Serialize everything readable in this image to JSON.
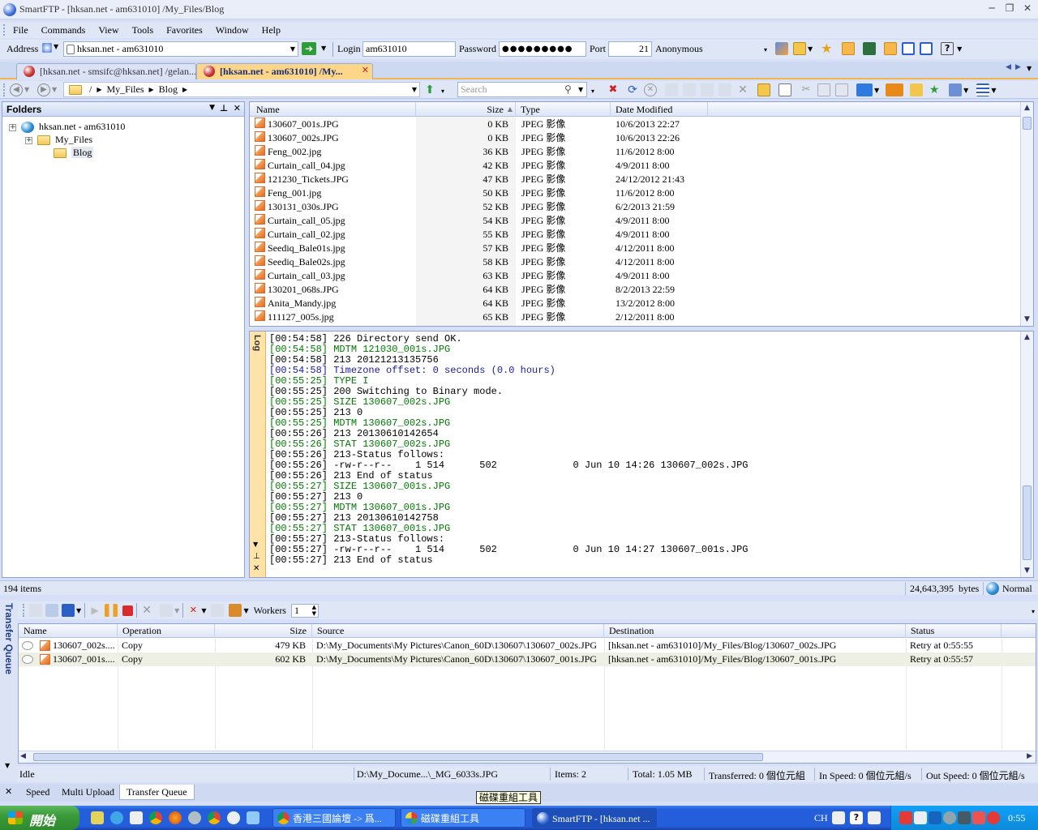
{
  "window": {
    "title": "SmartFTP - [hksan.net - am631010] /My_Files/Blog"
  },
  "menu": [
    "File",
    "Commands",
    "View",
    "Tools",
    "Favorites",
    "Window",
    "Help"
  ],
  "address_bar": {
    "address_label": "Address",
    "address_value": "hksan.net - am631010",
    "login_label": "Login",
    "login_value": "am631010",
    "password_label": "Password",
    "password_value": "●●●●●●●●●",
    "port_label": "Port",
    "port_value": "21",
    "anonymous_label": "Anonymous"
  },
  "tabs": [
    {
      "label": "[hksan.net - smsifc@hksan.net] /gelan...",
      "active": false
    },
    {
      "label": "[hksan.net - am631010] /My...",
      "active": true
    }
  ],
  "nav": {
    "path": [
      "/",
      "My_Files",
      "Blog"
    ],
    "search_placeholder": "Search"
  },
  "folders": {
    "header": "Folders",
    "tree": [
      {
        "label": "hksan.net - am631010",
        "level": 0,
        "expander": "+"
      },
      {
        "label": "My_Files",
        "level": 1,
        "expander": "+"
      },
      {
        "label": "Blog",
        "level": 2,
        "expander": ""
      }
    ]
  },
  "files": {
    "columns": [
      "Name",
      "Size",
      "Type",
      "Date Modified"
    ],
    "rows": [
      {
        "name": "130607_001s.JPG",
        "size": "0 KB",
        "type": "JPEG 影像",
        "date": "10/6/2013 22:27"
      },
      {
        "name": "130607_002s.JPG",
        "size": "0 KB",
        "type": "JPEG 影像",
        "date": "10/6/2013 22:26"
      },
      {
        "name": "Feng_002.jpg",
        "size": "36 KB",
        "type": "JPEG 影像",
        "date": "11/6/2012 8:00"
      },
      {
        "name": "Curtain_call_04.jpg",
        "size": "42 KB",
        "type": "JPEG 影像",
        "date": "4/9/2011 8:00"
      },
      {
        "name": "121230_Tickets.JPG",
        "size": "47 KB",
        "type": "JPEG 影像",
        "date": "24/12/2012 21:43"
      },
      {
        "name": "Feng_001.jpg",
        "size": "50 KB",
        "type": "JPEG 影像",
        "date": "11/6/2012 8:00"
      },
      {
        "name": "130131_030s.JPG",
        "size": "52 KB",
        "type": "JPEG 影像",
        "date": "6/2/2013 21:59"
      },
      {
        "name": "Curtain_call_05.jpg",
        "size": "54 KB",
        "type": "JPEG 影像",
        "date": "4/9/2011 8:00"
      },
      {
        "name": "Curtain_call_02.jpg",
        "size": "55 KB",
        "type": "JPEG 影像",
        "date": "4/9/2011 8:00"
      },
      {
        "name": "Seediq_Bale01s.jpg",
        "size": "57 KB",
        "type": "JPEG 影像",
        "date": "4/12/2011 8:00"
      },
      {
        "name": "Seediq_Bale02s.jpg",
        "size": "58 KB",
        "type": "JPEG 影像",
        "date": "4/12/2011 8:00"
      },
      {
        "name": "Curtain_call_03.jpg",
        "size": "63 KB",
        "type": "JPEG 影像",
        "date": "4/9/2011 8:00"
      },
      {
        "name": "130201_068s.JPG",
        "size": "64 KB",
        "type": "JPEG 影像",
        "date": "8/2/2013 22:59"
      },
      {
        "name": "Anita_Mandy.jpg",
        "size": "64 KB",
        "type": "JPEG 影像",
        "date": "13/2/2012 8:00"
      },
      {
        "name": "111127_005s.jpg",
        "size": "65 KB",
        "type": "JPEG 影像",
        "date": "2/12/2011 8:00"
      }
    ]
  },
  "log": {
    "label": "Log",
    "colors": {
      "command": "#007a00",
      "reply": "#000000",
      "info": "#1a1aa0"
    },
    "lines": [
      {
        "text": "[00:54:58] 226 Directory send OK.",
        "kind": "reply"
      },
      {
        "text": "[00:54:58] MDTM 121030_001s.JPG",
        "kind": "command"
      },
      {
        "text": "[00:54:58] 213 20121213135756",
        "kind": "reply"
      },
      {
        "text": "[00:54:58] Timezone offset: 0 seconds (0.0 hours)",
        "kind": "info"
      },
      {
        "text": "[00:55:25] TYPE I",
        "kind": "command"
      },
      {
        "text": "[00:55:25] 200 Switching to Binary mode.",
        "kind": "reply"
      },
      {
        "text": "[00:55:25] SIZE 130607_002s.JPG",
        "kind": "command"
      },
      {
        "text": "[00:55:25] 213 0",
        "kind": "reply"
      },
      {
        "text": "[00:55:25] MDTM 130607_002s.JPG",
        "kind": "command"
      },
      {
        "text": "[00:55:26] 213 20130610142654",
        "kind": "reply"
      },
      {
        "text": "[00:55:26] STAT 130607_002s.JPG",
        "kind": "command"
      },
      {
        "text": "[00:55:26] 213-Status follows:",
        "kind": "reply"
      },
      {
        "text": "[00:55:26] -rw-r--r--    1 514      502             0 Jun 10 14:26 130607_002s.JPG",
        "kind": "reply"
      },
      {
        "text": "[00:55:26] 213 End of status",
        "kind": "reply"
      },
      {
        "text": "[00:55:27] SIZE 130607_001s.JPG",
        "kind": "command"
      },
      {
        "text": "[00:55:27] 213 0",
        "kind": "reply"
      },
      {
        "text": "[00:55:27] MDTM 130607_001s.JPG",
        "kind": "command"
      },
      {
        "text": "[00:55:27] 213 20130610142758",
        "kind": "reply"
      },
      {
        "text": "[00:55:27] STAT 130607_001s.JPG",
        "kind": "command"
      },
      {
        "text": "[00:55:27] 213-Status follows:",
        "kind": "reply"
      },
      {
        "text": "[00:55:27] -rw-r--r--    1 514      502             0 Jun 10 14:27 130607_001s.JPG",
        "kind": "reply"
      },
      {
        "text": "[00:55:27] 213 End of status",
        "kind": "reply"
      }
    ]
  },
  "status1": {
    "items": "194 items",
    "bytes": "24,643,395",
    "bytes_unit": "bytes",
    "mode": "Normal"
  },
  "queue": {
    "side_label": "Transfer Queue",
    "workers_label": "Workers",
    "workers_value": "1",
    "columns": [
      "Name",
      "Operation",
      "Size",
      "Source",
      "Destination",
      "Status"
    ],
    "rows": [
      {
        "name": "130607_002s....",
        "operation": "Copy",
        "size": "479 KB",
        "source": "D:\\My_Documents\\My Pictures\\Canon_60D\\130607\\130607_002s.JPG",
        "destination": "[hksan.net - am631010]/My_Files/Blog/130607_002s.JPG",
        "status": "Retry at 0:55:55"
      },
      {
        "name": "130607_001s....",
        "operation": "Copy",
        "size": "602 KB",
        "source": "D:\\My_Documents\\My Pictures\\Canon_60D\\130607\\130607_001s.JPG",
        "destination": "[hksan.net - am631010]/My_Files/Blog/130607_001s.JPG",
        "status": "Retry at 0:55:57"
      }
    ],
    "status": {
      "state": "Idle",
      "file": "D:\\My_Docume...\\_MG_6033s.JPG",
      "items": "Items: 2",
      "total": "Total: 1.05 MB",
      "transferred": "Transferred: 0 個位元組",
      "in_speed": "In Speed: 0 個位元組/s",
      "out_speed": "Out Speed: 0 個位元組/s"
    }
  },
  "bottom_tabs": [
    {
      "label": "Speed",
      "active": false
    },
    {
      "label": "Multi Upload",
      "active": false
    },
    {
      "label": "Transfer Queue",
      "active": true
    }
  ],
  "tooltip": "磁碟重組工具",
  "taskbar": {
    "start_label": "開始",
    "buttons": [
      {
        "label": "香港三國論壇 -> 爲...",
        "active": false
      },
      {
        "label": "磁碟重組工具",
        "active": false
      },
      {
        "label": "SmartFTP - [hksan.net ...",
        "active": true
      }
    ],
    "lang": "CH",
    "clock": "0:55"
  }
}
